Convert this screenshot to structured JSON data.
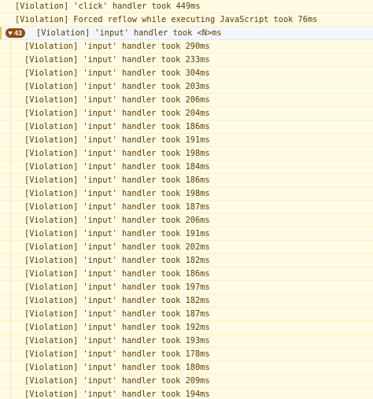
{
  "console": {
    "top_messages": [
      "[Violation] 'click' handler took 449ms",
      "[Violation] Forced reflow while executing JavaScript took 76ms"
    ],
    "group": {
      "count": "43",
      "label": "[Violation] 'input' handler took <N>ms",
      "children": [
        "[Violation] 'input' handler took 290ms",
        "[Violation] 'input' handler took 233ms",
        "[Violation] 'input' handler took 304ms",
        "[Violation] 'input' handler took 203ms",
        "[Violation] 'input' handler took 206ms",
        "[Violation] 'input' handler took 204ms",
        "[Violation] 'input' handler took 186ms",
        "[Violation] 'input' handler took 191ms",
        "[Violation] 'input' handler took 198ms",
        "[Violation] 'input' handler took 184ms",
        "[Violation] 'input' handler took 186ms",
        "[Violation] 'input' handler took 198ms",
        "[Violation] 'input' handler took 187ms",
        "[Violation] 'input' handler took 206ms",
        "[Violation] 'input' handler took 191ms",
        "[Violation] 'input' handler took 202ms",
        "[Violation] 'input' handler took 182ms",
        "[Violation] 'input' handler took 186ms",
        "[Violation] 'input' handler took 197ms",
        "[Violation] 'input' handler took 182ms",
        "[Violation] 'input' handler took 187ms",
        "[Violation] 'input' handler took 192ms",
        "[Violation] 'input' handler took 193ms",
        "[Violation] 'input' handler took 178ms",
        "[Violation] 'input' handler took 180ms",
        "[Violation] 'input' handler took 209ms",
        "[Violation] 'input' handler took 194ms"
      ]
    },
    "colors": {
      "background": "#fffbe5",
      "text": "#5c3c00",
      "badge": "#8a4b0a",
      "group_background": "#f3f6fc"
    }
  }
}
